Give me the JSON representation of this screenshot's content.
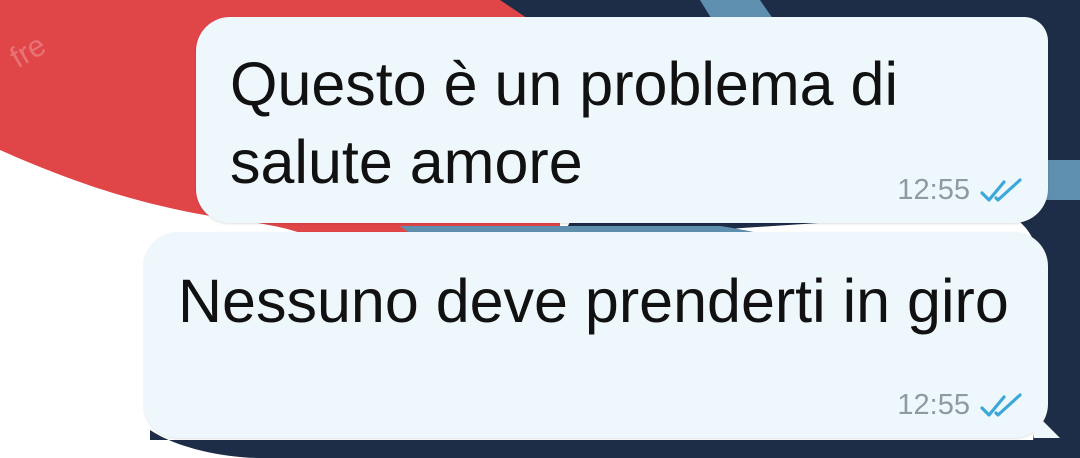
{
  "wallpaper": {
    "colors": {
      "red": "#e04548",
      "navy": "#1e2d47",
      "steel_blue": "#5f8fae",
      "white": "#ffffff"
    }
  },
  "bubble_color": "#eef7fb",
  "tick_color": "#3ba8d8",
  "messages": [
    {
      "text": "Questo è un problema di salute amore",
      "time": "12:55",
      "status_icon": "double-check-icon"
    },
    {
      "text": "Nessuno deve prenderti in giro",
      "time": "12:55",
      "status_icon": "double-check-icon"
    }
  ]
}
